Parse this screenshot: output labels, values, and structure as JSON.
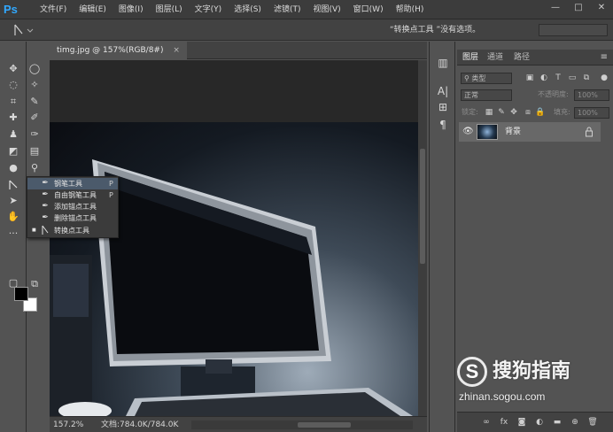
{
  "app": {
    "logo": "Ps",
    "menu": [
      "文件(F)",
      "编辑(E)",
      "图像(I)",
      "图层(L)",
      "文字(Y)",
      "选择(S)",
      "滤镜(T)",
      "视图(V)",
      "窗口(W)",
      "帮助(H)"
    ],
    "window_controls": [
      "—",
      "□",
      "✕"
    ]
  },
  "options_bar": {
    "tool_icon": "convert-point-icon",
    "message": "“转换点工具 ”没有选项。"
  },
  "document": {
    "tab_title": "timg.jpg @ 157%(RGB/8#)",
    "close_glyph": "×",
    "zoom": "157.2%",
    "doc_size": "文档:784.0K/784.0K"
  },
  "flyout": {
    "items": [
      {
        "icon": "pen-icon",
        "label": "钢笔工具",
        "shortcut": "P",
        "selected": false
      },
      {
        "icon": "freeform-pen-icon",
        "label": "自由钢笔工具",
        "shortcut": "P",
        "selected": false
      },
      {
        "icon": "add-anchor-icon",
        "label": "添加锚点工具",
        "shortcut": "",
        "selected": false
      },
      {
        "icon": "delete-anchor-icon",
        "label": "删除锚点工具",
        "shortcut": "",
        "selected": false
      },
      {
        "icon": "convert-point-icon",
        "label": "转换点工具",
        "shortcut": "",
        "selected": true
      }
    ],
    "bullet": "■"
  },
  "layers_panel": {
    "tabs": [
      "图层",
      "通道",
      "路径"
    ],
    "filter_placeholder": "类型",
    "blend_mode": "正常",
    "opacity_label": "不透明度:",
    "opacity_value": "100%",
    "lock_label": "锁定:",
    "fill_label": "填充:",
    "fill_value": "100%",
    "layer": {
      "name": "背景",
      "visible": true,
      "locked": true
    }
  },
  "watermark": {
    "logo_letter": "S",
    "name": "搜狗指南",
    "url": "zhinan.sogou.com"
  },
  "colors": {
    "foreground": "#000000",
    "background": "#ffffff",
    "accent": "#31a8ff"
  }
}
